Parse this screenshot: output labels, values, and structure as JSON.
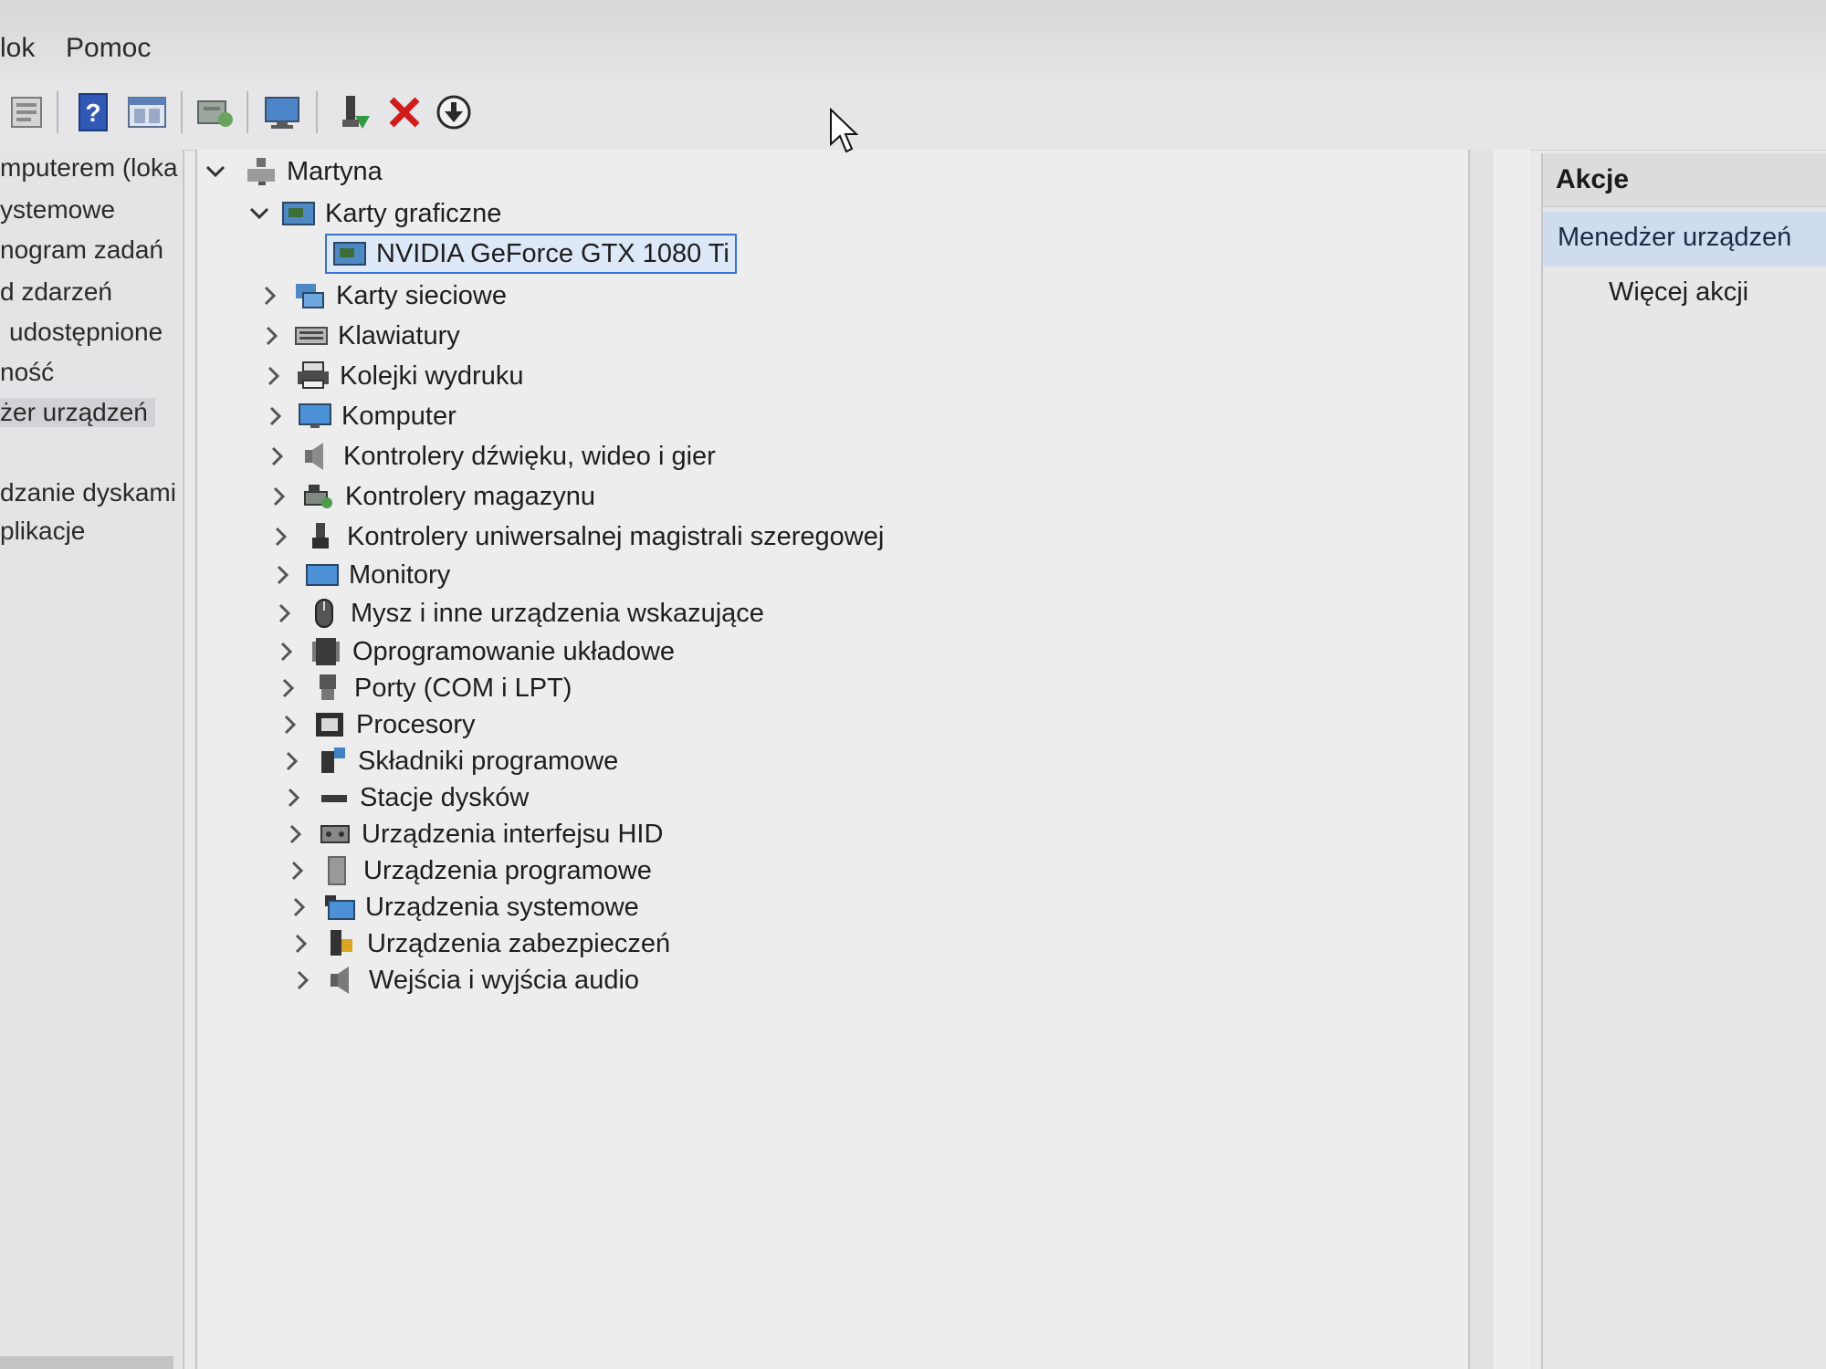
{
  "menu": {
    "items": [
      "lok",
      "Pomoc"
    ]
  },
  "toolbar": {
    "buttons": [
      "properties-icon",
      "help-icon",
      "view-icon",
      "scan-hardware-icon",
      "monitor-icon",
      "enable-device-icon",
      "uninstall-icon",
      "update-driver-icon"
    ]
  },
  "left_pane": {
    "items": [
      "mputerem (loka",
      "ystemowe",
      "nogram zadań",
      "d zdarzeń",
      "udostępnione",
      "ność",
      "żer urządzeń",
      "dzanie dyskami",
      "plikacje"
    ]
  },
  "tree": {
    "root": "Martyna",
    "expanded_category": "Karty graficzne",
    "selected_device": "NVIDIA GeForce GTX 1080 Ti",
    "categories": [
      "Karty sieciowe",
      "Klawiatury",
      "Kolejki wydruku",
      "Komputer",
      "Kontrolery dźwięku, wideo i gier",
      "Kontrolery magazynu",
      "Kontrolery uniwersalnej magistrali szeregowej",
      "Monitory",
      "Mysz i inne urządzenia wskazujące",
      "Oprogramowanie układowe",
      "Porty (COM i LPT)",
      "Procesory",
      "Składniki programowe",
      "Stacje dysków",
      "Urządzenia interfejsu HID",
      "Urządzenia programowe",
      "Urządzenia systemowe",
      "Urządzenia zabezpieczeń",
      "Wejścia i wyjścia audio"
    ]
  },
  "actions": {
    "title": "Akcje",
    "section": "Menedżer urządzeń",
    "more": "Więcej akcji"
  }
}
